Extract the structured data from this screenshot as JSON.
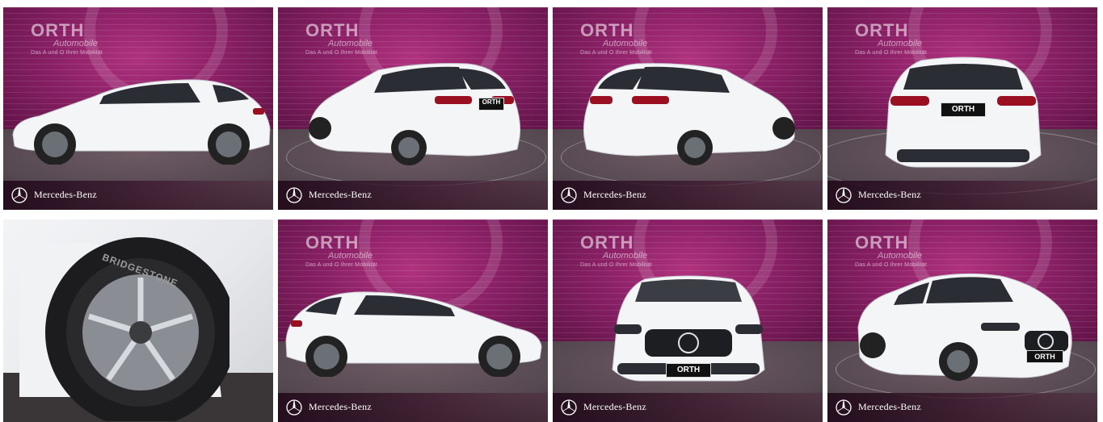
{
  "gallery": {
    "brand_label": "Mercedes-Benz",
    "dealer_logo": {
      "main": "ORTH",
      "sub": "Automobile",
      "tagline": "Das A und O Ihrer Mobilität"
    },
    "plate_text": "ORTH",
    "tire_text": "BRIDGESTONE",
    "photos": [
      {
        "view": "side-left"
      },
      {
        "view": "rear-three-quarter-left"
      },
      {
        "view": "rear-three-quarter-right"
      },
      {
        "view": "rear"
      },
      {
        "view": "wheel-closeup"
      },
      {
        "view": "side-right"
      },
      {
        "view": "front"
      },
      {
        "view": "front-three-quarter"
      }
    ]
  },
  "colors": {
    "wall": "#8a2066",
    "floor": "#564951",
    "car": "#f4f5f7",
    "footer": "#2a0f20"
  }
}
